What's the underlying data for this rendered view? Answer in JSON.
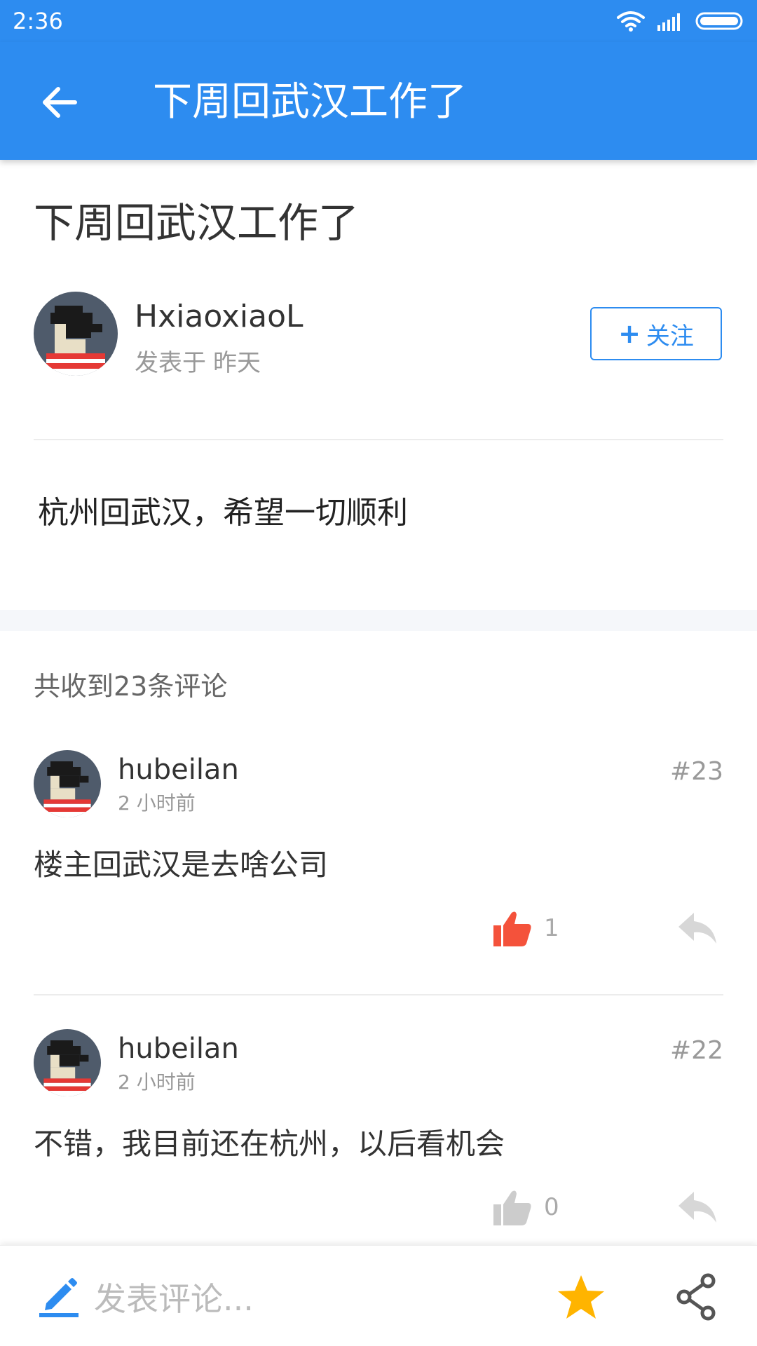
{
  "status_bar": {
    "time": "2:36"
  },
  "app_bar": {
    "title": "下周回武汉工作了"
  },
  "post": {
    "title": "下周回武汉工作了",
    "author": "HxiaoxiaoL",
    "posted_prefix": "发表于",
    "posted_time": "昨天",
    "follow_plus": "+",
    "follow_label": "关注",
    "content": "杭州回武汉，希望一切顺利"
  },
  "comments_header": "共收到23条评论",
  "comments": [
    {
      "user": "hubeilan",
      "time": "2 小时前",
      "floor": "#23",
      "text": "楼主回武汉是去啥公司",
      "likes": "1",
      "liked": true
    },
    {
      "user": "hubeilan",
      "time": "2 小时前",
      "floor": "#22",
      "text": "不错，我目前还在杭州，以后看机会",
      "likes": "0",
      "liked": false
    }
  ],
  "bottom_bar": {
    "compose_placeholder": "发表评论..."
  },
  "icons": {
    "back": "arrow-left-icon",
    "compose": "pencil-icon",
    "favorite": "star-icon",
    "share": "share-icon",
    "like": "thumbs-up-icon",
    "reply": "reply-icon",
    "wifi": "wifi-icon",
    "signal": "signal-icon",
    "battery": "battery-icon"
  },
  "colors": {
    "primary": "#2d8cf0",
    "liked": "#f4523b",
    "unliked": "#cccccc",
    "star": "#ffb400"
  }
}
